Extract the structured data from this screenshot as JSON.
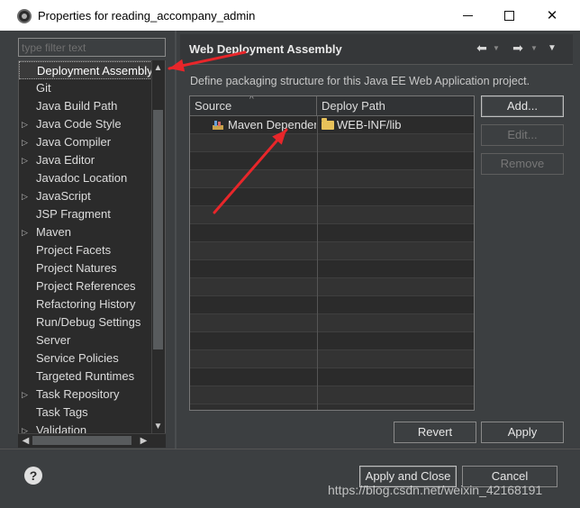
{
  "window": {
    "title": "Properties for reading_accompany_admin",
    "icon": "eclipse-icon"
  },
  "filter": {
    "placeholder": "type filter text"
  },
  "tree": {
    "selected": "Deployment Assembly",
    "items": [
      {
        "label": "Deployment Assembly",
        "expandable": false
      },
      {
        "label": "Git",
        "expandable": false
      },
      {
        "label": "Java Build Path",
        "expandable": false
      },
      {
        "label": "Java Code Style",
        "expandable": true
      },
      {
        "label": "Java Compiler",
        "expandable": true
      },
      {
        "label": "Java Editor",
        "expandable": true
      },
      {
        "label": "Javadoc Location",
        "expandable": false
      },
      {
        "label": "JavaScript",
        "expandable": true
      },
      {
        "label": "JSP Fragment",
        "expandable": false
      },
      {
        "label": "Maven",
        "expandable": true
      },
      {
        "label": "Project Facets",
        "expandable": false
      },
      {
        "label": "Project Natures",
        "expandable": false
      },
      {
        "label": "Project References",
        "expandable": false
      },
      {
        "label": "Refactoring History",
        "expandable": false
      },
      {
        "label": "Run/Debug Settings",
        "expandable": false
      },
      {
        "label": "Server",
        "expandable": false
      },
      {
        "label": "Service Policies",
        "expandable": false
      },
      {
        "label": "Targeted Runtimes",
        "expandable": false
      },
      {
        "label": "Task Repository",
        "expandable": true
      },
      {
        "label": "Task Tags",
        "expandable": false
      },
      {
        "label": "Validation",
        "expandable": true
      }
    ]
  },
  "page": {
    "title": "Web Deployment Assembly",
    "description": "Define packaging structure for this Java EE Web Application project.",
    "table": {
      "columns": [
        "Source",
        "Deploy Path"
      ],
      "rows": [
        {
          "source": "Maven Dependen",
          "deploy_path": "WEB-INF/lib"
        }
      ]
    },
    "buttons": {
      "add": "Add...",
      "edit": "Edit...",
      "remove": "Remove",
      "revert": "Revert",
      "apply": "Apply"
    }
  },
  "footer": {
    "apply_close": "Apply and Close",
    "cancel": "Cancel"
  },
  "watermark": "https://blog.csdn.net/weixin_42168191",
  "colors": {
    "annotation_arrow": "#e8262a",
    "background": "#3c3f41"
  }
}
